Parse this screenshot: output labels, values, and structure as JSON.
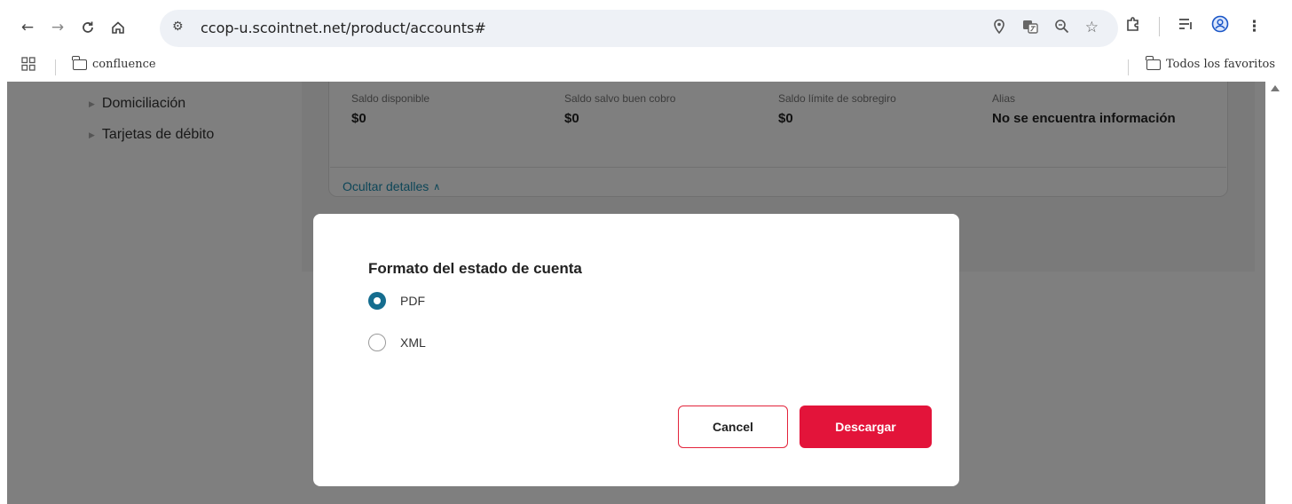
{
  "browser": {
    "url": "ccop-u.scointnet.net/product/accounts#",
    "icons": [
      "back-icon",
      "forward-icon",
      "reload-icon",
      "home-icon",
      "site-settings-icon",
      "location-icon",
      "translate-icon",
      "zoom-icon",
      "bookmark-star-icon",
      "extensions-icon",
      "reading-list-icon",
      "profile-icon",
      "menu-icon"
    ]
  },
  "bookmarks": {
    "items": [
      {
        "label": "confluence"
      }
    ],
    "all_bookmarks": "Todos los favoritos"
  },
  "sidebar": {
    "items": [
      {
        "label": "Domiciliación"
      },
      {
        "label": "Tarjetas de débito"
      }
    ]
  },
  "account_details": {
    "fields": [
      {
        "label": "Saldo disponible",
        "value": "$0"
      },
      {
        "label": "Saldo salvo buen cobro",
        "value": "$0"
      },
      {
        "label": "Saldo límite de sobregiro",
        "value": "$0"
      },
      {
        "label": "Alias",
        "value": "No se encuentra información"
      }
    ],
    "toggle_label": "Ocultar detalles"
  },
  "modal": {
    "title": "Formato del estado de cuenta",
    "options": [
      {
        "label": "PDF",
        "selected": true
      },
      {
        "label": "XML",
        "selected": false
      }
    ],
    "cancel_label": "Cancel",
    "submit_label": "Descargar"
  },
  "colors": {
    "accent": "#156d8f",
    "primary_button": "#e3143a",
    "link": "#1a8cb0"
  }
}
